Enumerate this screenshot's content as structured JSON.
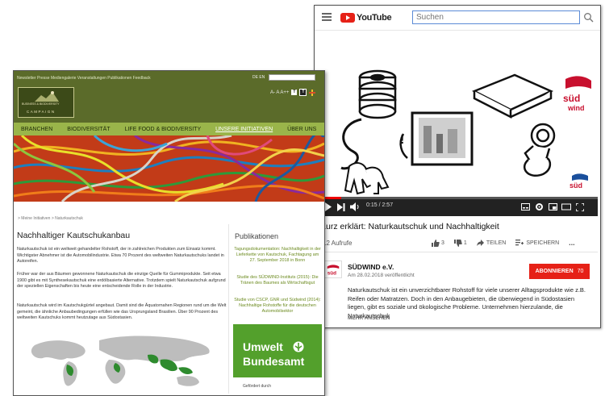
{
  "youtube": {
    "brand": "YouTube",
    "search_placeholder": "Suchen",
    "player": {
      "time": "0:15 / 2:57",
      "progress": 0.085,
      "overlay_logo": "süd wind"
    },
    "video_title": "Kurz erklärt: Naturkautschuk und Nachhaltigkeit",
    "views": "12 Aufrufe",
    "likes": "3",
    "dislikes": "1",
    "share_label": "TEILEN",
    "save_label": "SPEICHERN",
    "more_label": "...",
    "channel": {
      "name": "SÜDWIND e.V.",
      "published": "Am 28.02.2018 veröffentlicht",
      "subscribe_label": "ABONNIEREN",
      "subscriber_count": "70"
    },
    "description": "Naturkautschuk ist ein unverzichtbarer Rohstoff für viele unserer Alltagsprodukte wie z.B. Reifen oder Matratzen. Doch in den Anbaugebieten, die überwiegend in Südostasien liegen, gibt es soziale und ökologische Probleme. Unternehmen hierzulande, die Naturkautschuk",
    "show_more_label": "MEHR ANSEHEN"
  },
  "ngo_site": {
    "top_links": "Newsletter  Presse  Mediengalerie  Veranstaltungen  Publikationen  Feedback",
    "lang": "DE  EN",
    "logo_line1": "BUSINESS & BIODIVERSITY",
    "logo_line2": "CAMPAIGN",
    "font_controls": "A-  A  A++",
    "nav": [
      "BRANCHEN",
      "BIODIVERSITÄT",
      "LIFE FOOD & BIODIVERSITY",
      "UNSERE INITIATIVEN",
      "ÜBER UNS"
    ],
    "nav_active_index": 3,
    "breadcrumb": "> Meine Initiativen  > Naturkautschuk",
    "heading": "Nachhaltiger Kautschukanbau",
    "paragraphs": [
      "Naturkautschuk ist ein weltweit gehandelter Rohstoff, der in zahlreichen Produkten zum Einsatz kommt. Wichtigster Abnehmer ist die Automobilindustrie. Etwa 70 Prozent des weltweiten Naturkautschuks landet in Autoreifen.",
      "Früher war der aus Bäumen gewonnene Naturkautschuk die einzige Quelle für Gummiprodukte. Seit etwa 1900 gibt es mit Synthesekautschuk eine erdölbasierte Alternative. Trotzdem spielt Naturkautschuk aufgrund der speziellen Eigenschaften bis heute eine entscheidende Rolle in der Industrie.",
      "Naturkautschuk wird im Kautschukgürtel angebaut. Damit sind die Äquatornahen Regionen rund um die Welt gemeint, die ähnliche Anbaubedingungen erfüllen wie das Ursprungsland Brasilien. Über 90 Prozent des weltweiten Kautschuks kommt heutzutage aus Südostasien."
    ],
    "sidebar_title": "Publikationen",
    "publications": [
      "Tagungsdokumentation: Nachhaltigkeit in der Lieferkette von Kautschuk, Fachtagung am 27. September 2018 in Bonn",
      "Studie des SÜDWIND-Instituts (2015): Die Tränen des Baumes als Wirtschaftsgut",
      "Studie von CSCP, GNR und Südwind (2014): Nachhaltige Rohstoffe für die deutschen Automobilsektor"
    ],
    "uba_line1": "Umwelt",
    "uba_line2": "Bundesamt",
    "funded_by": "Gefördert durch"
  }
}
